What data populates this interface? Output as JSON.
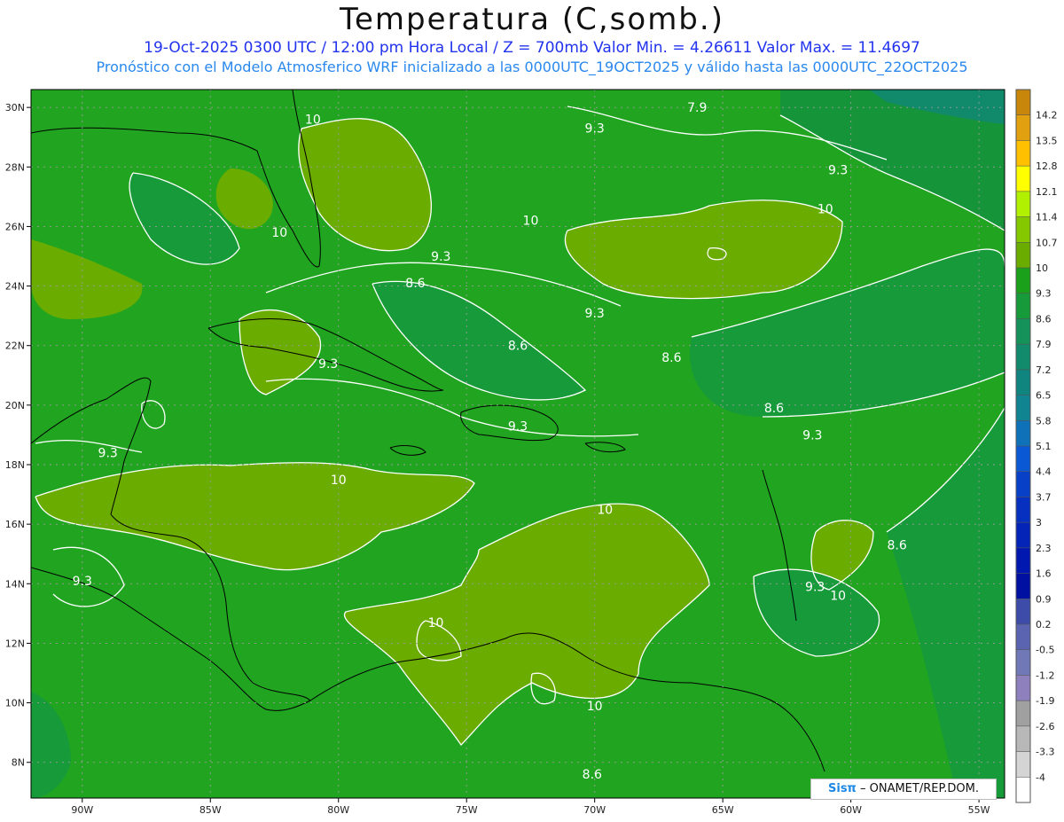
{
  "header": {
    "title": "Temperatura (C,somb.)",
    "line1": "19-Oct-2025  0300 UTC / 12:00 pm Hora Local / Z = 700mb   Valor Min. = 4.26611  Valor Max. = 11.4697",
    "line2": "Pronóstico con el Modelo Atmosferico WRF inicializado a las 0000UTC_19OCT2025 y válido hasta las  0000UTC_22OCT2025"
  },
  "map": {
    "lon_range": [
      -92,
      -54
    ],
    "lat_range": [
      6.8,
      30.6
    ],
    "lon_ticks": [
      "90W",
      "85W",
      "80W",
      "75W",
      "70W",
      "65W",
      "60W",
      "55W"
    ],
    "lat_ticks": [
      "30N",
      "28N",
      "26N",
      "24N",
      "22N",
      "20N",
      "18N",
      "16N",
      "14N",
      "12N",
      "10N",
      "8N"
    ],
    "background_color": "#21a521",
    "contour_labels": [
      {
        "text": "10",
        "lon": -81,
        "lat": 29.6
      },
      {
        "text": "7.9",
        "lon": -66,
        "lat": 30.0
      },
      {
        "text": "9.3",
        "lon": -70,
        "lat": 29.3
      },
      {
        "text": "9.3",
        "lon": -60.5,
        "lat": 27.9
      },
      {
        "text": "10",
        "lon": -82.3,
        "lat": 25.8
      },
      {
        "text": "10",
        "lon": -72.5,
        "lat": 26.2
      },
      {
        "text": "10",
        "lon": -61,
        "lat": 26.6
      },
      {
        "text": "9.3",
        "lon": -76,
        "lat": 25.0
      },
      {
        "text": "8.6",
        "lon": -77,
        "lat": 24.1
      },
      {
        "text": "9.3",
        "lon": -70,
        "lat": 23.1
      },
      {
        "text": "8.6",
        "lon": -73,
        "lat": 22.0
      },
      {
        "text": "8.6",
        "lon": -67,
        "lat": 21.6
      },
      {
        "text": "9.3",
        "lon": -80.4,
        "lat": 21.4
      },
      {
        "text": "8.6",
        "lon": -63,
        "lat": 19.9
      },
      {
        "text": "9.3",
        "lon": -73,
        "lat": 19.3
      },
      {
        "text": "9.3",
        "lon": -61.5,
        "lat": 19.0
      },
      {
        "text": "9.3",
        "lon": -89,
        "lat": 18.4
      },
      {
        "text": "10",
        "lon": -80,
        "lat": 17.5
      },
      {
        "text": "10",
        "lon": -69.6,
        "lat": 16.5
      },
      {
        "text": "8.6",
        "lon": -58.2,
        "lat": 15.3
      },
      {
        "text": "9.3",
        "lon": -90,
        "lat": 14.1
      },
      {
        "text": "9.3",
        "lon": -61.4,
        "lat": 13.9
      },
      {
        "text": "10",
        "lon": -60.5,
        "lat": 13.6
      },
      {
        "text": "10",
        "lon": -76.2,
        "lat": 12.7
      },
      {
        "text": "10",
        "lon": -70,
        "lat": 9.9
      },
      {
        "text": "8.6",
        "lon": -70.1,
        "lat": 7.6
      }
    ]
  },
  "legend": {
    "labels": [
      "14.2",
      "13.5",
      "12.8",
      "12.1",
      "11.4",
      "10.7",
      "10",
      "9.3",
      "8.6",
      "7.9",
      "7.2",
      "6.5",
      "5.8",
      "5.1",
      "4.4",
      "3.7",
      "3",
      "2.3",
      "1.6",
      "0.9",
      "0.2",
      "-0.5",
      "-1.2",
      "-1.9",
      "-2.6",
      "-3.3",
      "-4"
    ],
    "colors": [
      "#c8860a",
      "#e0a010",
      "#ffc000",
      "#ffff00",
      "#b0f000",
      "#86c800",
      "#6aac00",
      "#1aa01a",
      "#169a3a",
      "#14925a",
      "#128a6c",
      "#10847e",
      "#108490",
      "#0f72b8",
      "#0a58d4",
      "#0840c8",
      "#0630c0",
      "#0424b8",
      "#0018b0",
      "#0010a0",
      "#3c4ca8",
      "#5a64b0",
      "#7078b8",
      "#8e80bc",
      "#a0a0a0",
      "#b8b8b8",
      "#d4d4d4",
      "#ffffff"
    ]
  },
  "credit": {
    "logo": "Sisπ",
    "text": " – ONAMET/REP.DOM."
  }
}
